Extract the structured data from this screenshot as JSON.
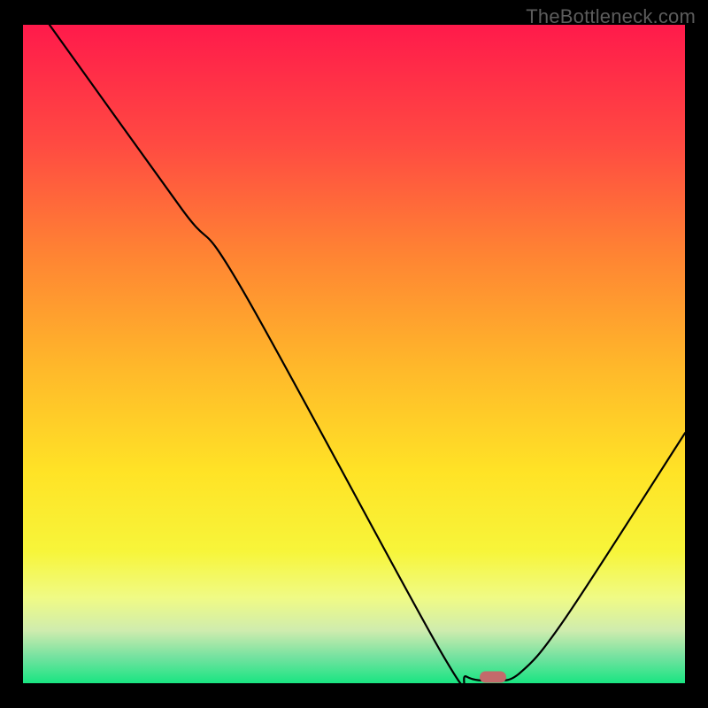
{
  "watermark": {
    "text": "TheBottleneck.com"
  },
  "chart_data": {
    "type": "line",
    "title": "",
    "xlabel": "",
    "ylabel": "",
    "xlim": [
      0,
      100
    ],
    "ylim": [
      0,
      100
    ],
    "grid": false,
    "series": [
      {
        "name": "bottleneck-curve",
        "color": "#000000",
        "points": [
          {
            "x": 4,
            "y": 100
          },
          {
            "x": 24,
            "y": 72
          },
          {
            "x": 33,
            "y": 60
          },
          {
            "x": 63,
            "y": 5
          },
          {
            "x": 67,
            "y": 1
          },
          {
            "x": 71,
            "y": 0.5
          },
          {
            "x": 75,
            "y": 1.5
          },
          {
            "x": 82,
            "y": 10
          },
          {
            "x": 100,
            "y": 38
          }
        ]
      }
    ],
    "optimal_marker": {
      "x": 71,
      "y": 1,
      "color": "#c36a6b"
    },
    "gradient_stops": [
      {
        "t": 0.0,
        "color": "#ff1a4b"
      },
      {
        "t": 0.18,
        "color": "#ff4a42"
      },
      {
        "t": 0.35,
        "color": "#ff8433"
      },
      {
        "t": 0.52,
        "color": "#ffb82a"
      },
      {
        "t": 0.68,
        "color": "#ffe326"
      },
      {
        "t": 0.8,
        "color": "#f7f53a"
      },
      {
        "t": 0.87,
        "color": "#f0fb85"
      },
      {
        "t": 0.92,
        "color": "#cfecae"
      },
      {
        "t": 0.96,
        "color": "#75e2a0"
      },
      {
        "t": 1.0,
        "color": "#19e582"
      }
    ]
  }
}
